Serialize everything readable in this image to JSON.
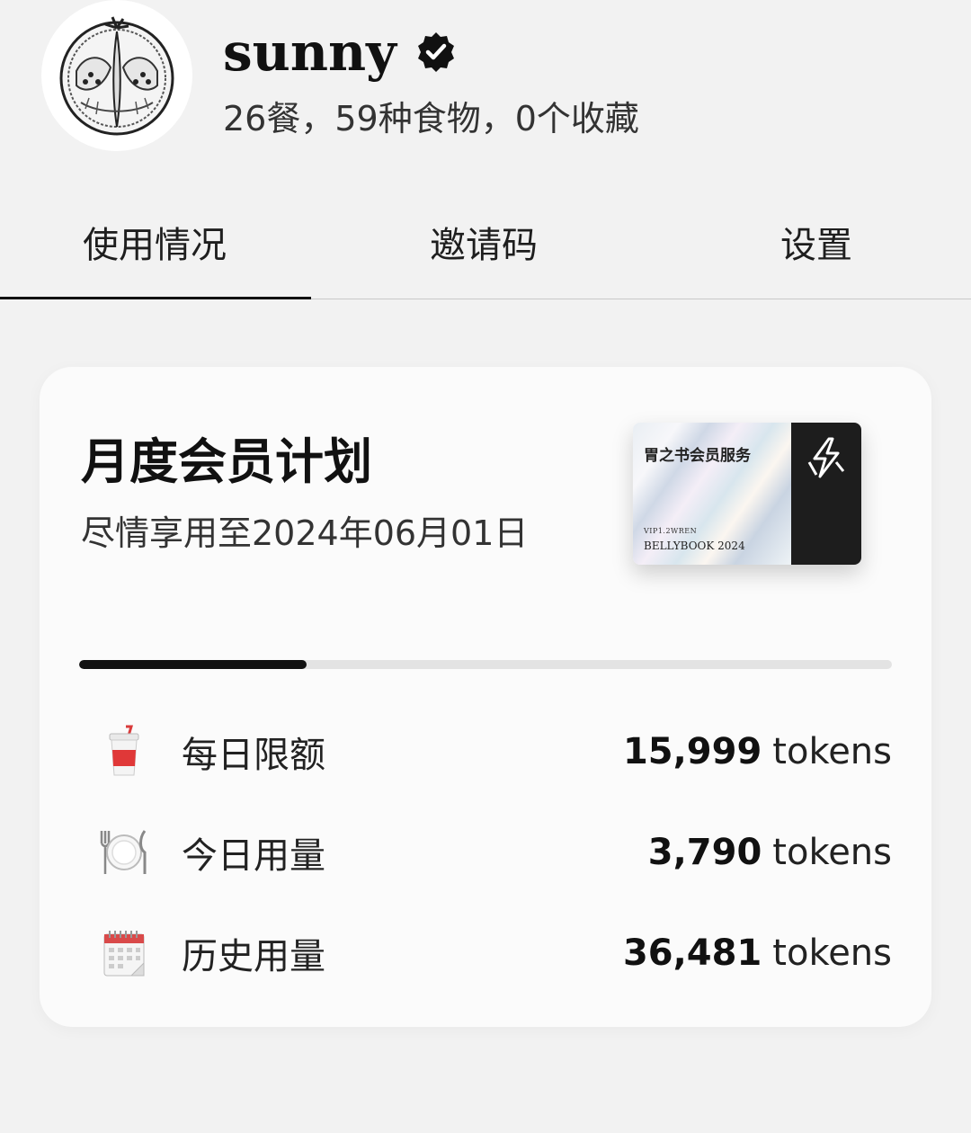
{
  "profile": {
    "username": "sunny",
    "stats": "26餐，59种食物，0个收藏"
  },
  "tabs": [
    {
      "label": "使用情况",
      "active": true
    },
    {
      "label": "邀请码",
      "active": false
    },
    {
      "label": "设置",
      "active": false
    }
  ],
  "plan": {
    "title": "月度会员计划",
    "subtitle": "尽情享用至2024年06月01日",
    "progress_percent": 28
  },
  "member_card": {
    "name": "胃之书会员服务",
    "vip_code": "VIP1.2WREN",
    "brand": "BELLYBOOK  2024"
  },
  "usage": [
    {
      "icon": "cup-with-straw-icon",
      "label": "每日限额",
      "value": "15,999",
      "unit": "tokens"
    },
    {
      "icon": "plate-cutlery-icon",
      "label": "今日用量",
      "value": "3,790",
      "unit": "tokens"
    },
    {
      "icon": "calendar-icon",
      "label": "历史用量",
      "value": "36,481",
      "unit": "tokens"
    }
  ],
  "colors": {
    "background": "#f2f2f2",
    "card": "#fbfbfb",
    "accent": "#111111",
    "progress_track": "#e3e3e3"
  }
}
